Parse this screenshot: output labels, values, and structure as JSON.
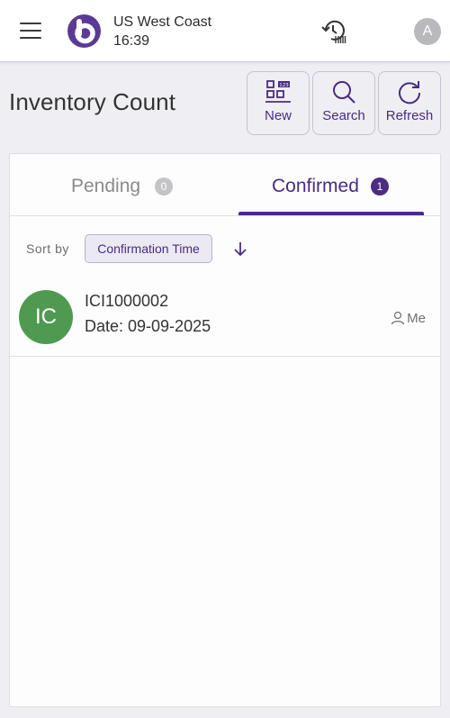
{
  "header": {
    "location": "US West Coast",
    "time": "16:39",
    "user_initial": "A"
  },
  "page": {
    "title": "Inventory Count"
  },
  "toolbar": {
    "new_label": "New",
    "search_label": "Search",
    "refresh_label": "Refresh"
  },
  "tabs": [
    {
      "label": "Pending",
      "count": "0",
      "active": false
    },
    {
      "label": "Confirmed",
      "count": "1",
      "active": true
    }
  ],
  "sort": {
    "label": "Sort by",
    "field": "Confirmation Time",
    "direction": "descending"
  },
  "items": [
    {
      "initials": "IC",
      "code": "ICI1000002",
      "date": "Date: 09-09-2025",
      "owner": "Me",
      "avatar_color": "#4e9a51"
    }
  ],
  "colors": {
    "accent": "#4a2c83",
    "background": "#efeef3"
  },
  "icons": {
    "menu": "hamburger-icon",
    "logo": "app-logo",
    "sync": "history-sync-icon",
    "new": "barcode-grid-icon",
    "search": "search-icon",
    "refresh": "refresh-icon",
    "sort": "arrow-down-icon",
    "owner": "person-icon"
  }
}
